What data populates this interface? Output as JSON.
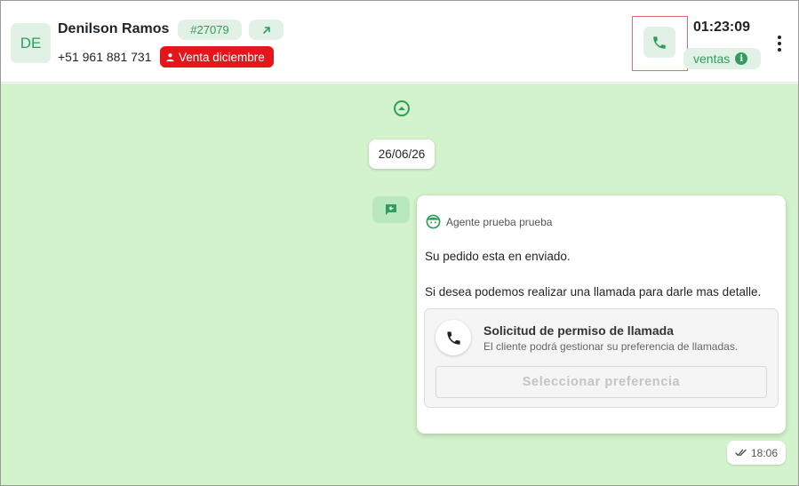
{
  "contact": {
    "initials": "DE",
    "name": "Denilson Ramos",
    "ticket": "#27079",
    "phone": "+51 961 881 731",
    "tag": "Venta diciembre"
  },
  "call": {
    "timer": "01:23:09",
    "queue": "ventas",
    "info_icon_glyph": "i"
  },
  "chat": {
    "date": "26/06/26",
    "message": {
      "agent": "Agente prueba prueba",
      "line1": "Su pedido esta en enviado.",
      "line2": "Si desea podemos realizar una llamada para darle mas detalle.",
      "permission": {
        "title": "Solicitud de permiso de llamada",
        "description": "El cliente podrá gestionar su preferencia de llamadas.",
        "button": "Seleccionar preferencia"
      },
      "time": "18:06",
      "status": "read"
    }
  },
  "colors": {
    "brand_green": "#2f9e5c",
    "chat_background": "#d2f3cb",
    "tag_red": "#e4161b",
    "highlight_border": "#e06c6c"
  },
  "icons": [
    "arrow-up-right-icon",
    "person-icon",
    "phone-icon",
    "info-icon",
    "more-vertical-icon",
    "chevron-up-circle-icon",
    "message-in-icon",
    "agent-face-icon",
    "double-check-icon"
  ]
}
